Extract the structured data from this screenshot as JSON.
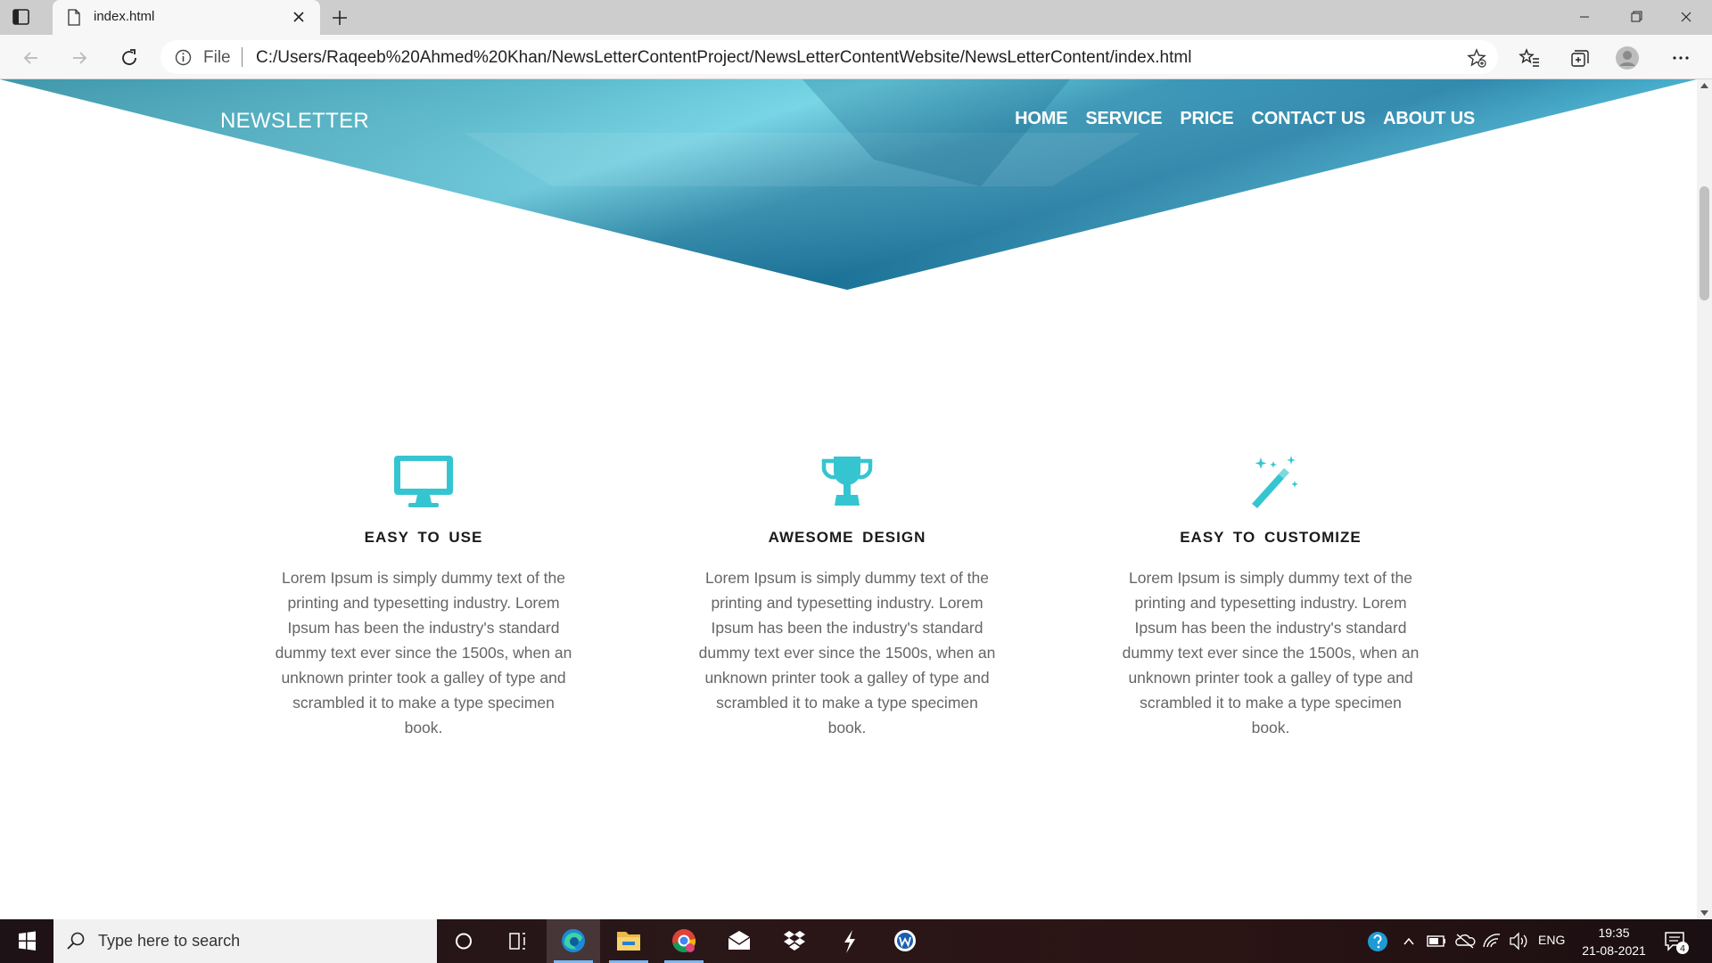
{
  "browser": {
    "tab_title": "index.html",
    "file_label": "File",
    "url": "C:/Users/Raqeeb%20Ahmed%20Khan/NewsLetterContentProject/NewsLetterContentWebsite/NewsLetterContent/index.html"
  },
  "site": {
    "brand": "NEWSLETTER",
    "nav": [
      "HOME",
      "SERVICE",
      "PRICE",
      "CONTACT US",
      "ABOUT US"
    ],
    "accent_color": "#35c5d0",
    "features": [
      {
        "icon": "desktop-icon",
        "title": "EASY  TO  USE",
        "text": "Lorem Ipsum is simply dummy text of the printing and typesetting industry. Lorem Ipsum has been the industry's standard dummy text ever since the 1500s, when an unknown printer took a galley of type and scrambled it to make a type specimen book."
      },
      {
        "icon": "trophy-icon",
        "title": "AWESOME  DESIGN",
        "text": "Lorem Ipsum is simply dummy text of the printing and typesetting industry. Lorem Ipsum has been the industry's standard dummy text ever since the 1500s, when an unknown printer took a galley of type and scrambled it to make a type specimen book."
      },
      {
        "icon": "magic-wand-icon",
        "title": "EASY  TO  CUSTOMIZE",
        "text": "Lorem Ipsum is simply dummy text of the printing and typesetting industry. Lorem Ipsum has been the industry's standard dummy text ever since the 1500s, when an unknown printer took a galley of type and scrambled it to make a type specimen book."
      }
    ]
  },
  "taskbar": {
    "search_placeholder": "Type here to search",
    "language": "ENG",
    "time": "19:35",
    "date": "21-08-2021",
    "notification_count": "4"
  }
}
